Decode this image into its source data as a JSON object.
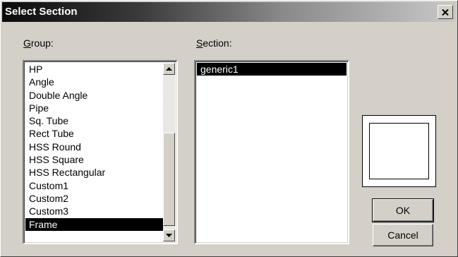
{
  "dialog": {
    "title": "Select Section",
    "close_icon": "close-icon"
  },
  "group": {
    "label": "Group:",
    "items": [
      "HP",
      "Angle",
      "Double Angle",
      "Pipe",
      "Sq. Tube",
      "Rect Tube",
      "HSS Round",
      "HSS Square",
      "HSS Rectangular",
      "Custom1",
      "Custom2",
      "Custom3",
      "Frame"
    ],
    "selected": "Frame"
  },
  "section": {
    "label": "Section:",
    "items": [
      "generic1"
    ],
    "selected": "generic1"
  },
  "buttons": {
    "ok": "OK",
    "cancel": "Cancel"
  },
  "colors": {
    "selection": "#000000",
    "face": "#d4d0c8"
  }
}
